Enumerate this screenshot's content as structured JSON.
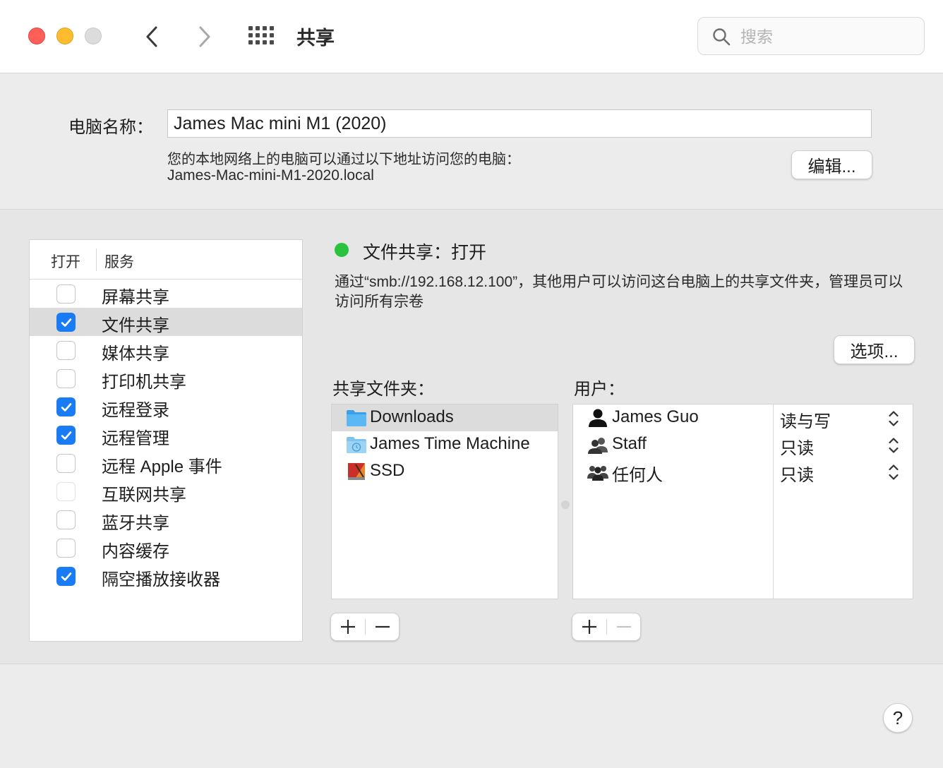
{
  "window": {
    "title": "共享"
  },
  "search": {
    "placeholder": "搜索"
  },
  "computer_name": {
    "label": "电脑名称：",
    "value": "James Mac mini M1 (2020)",
    "description": "您的本地网络上的电脑可以通过以下地址访问您的电脑：",
    "address": "James-Mac-mini-M1-2020.local",
    "edit_label": "编辑..."
  },
  "services": {
    "header_on": "打开",
    "header_service": "服务",
    "items": [
      {
        "label": "屏幕共享",
        "checked": false,
        "dim": false,
        "selected": false
      },
      {
        "label": "文件共享",
        "checked": true,
        "dim": false,
        "selected": true
      },
      {
        "label": "媒体共享",
        "checked": false,
        "dim": false,
        "selected": false
      },
      {
        "label": "打印机共享",
        "checked": false,
        "dim": false,
        "selected": false
      },
      {
        "label": "远程登录",
        "checked": true,
        "dim": false,
        "selected": false
      },
      {
        "label": "远程管理",
        "checked": true,
        "dim": false,
        "selected": false
      },
      {
        "label": "远程 Apple 事件",
        "checked": false,
        "dim": false,
        "selected": false
      },
      {
        "label": "互联网共享",
        "checked": false,
        "dim": true,
        "selected": false
      },
      {
        "label": "蓝牙共享",
        "checked": false,
        "dim": false,
        "selected": false
      },
      {
        "label": "内容缓存",
        "checked": false,
        "dim": false,
        "selected": false
      },
      {
        "label": "隔空播放接收器",
        "checked": true,
        "dim": false,
        "selected": false
      }
    ]
  },
  "status": {
    "color": "#2bc240",
    "text": "文件共享：打开",
    "description": "通过“smb://192.168.12.100”，其他用户可以访问这台电脑上的共享文件夹，管理员可以访问所有宗卷",
    "options_label": "选项..."
  },
  "shared_folders": {
    "label": "共享文件夹：",
    "items": [
      {
        "label": "Downloads",
        "icon": "folder-icon",
        "selected": true
      },
      {
        "label": "James Time Machine",
        "icon": "time-machine-folder-icon",
        "selected": false
      },
      {
        "label": "SSD",
        "icon": "drive-icon",
        "selected": false
      }
    ]
  },
  "users": {
    "label": "用户：",
    "items": [
      {
        "name": "James Guo",
        "permission": "读与写",
        "icon": "user-icon"
      },
      {
        "name": "Staff",
        "permission": "只读",
        "icon": "group-icon"
      },
      {
        "name": "任何人",
        "permission": "只读",
        "icon": "everyone-icon"
      }
    ]
  },
  "help": {
    "label": "?"
  },
  "colors": {
    "accent": "#1a7cf5",
    "status_on": "#2bc240"
  }
}
